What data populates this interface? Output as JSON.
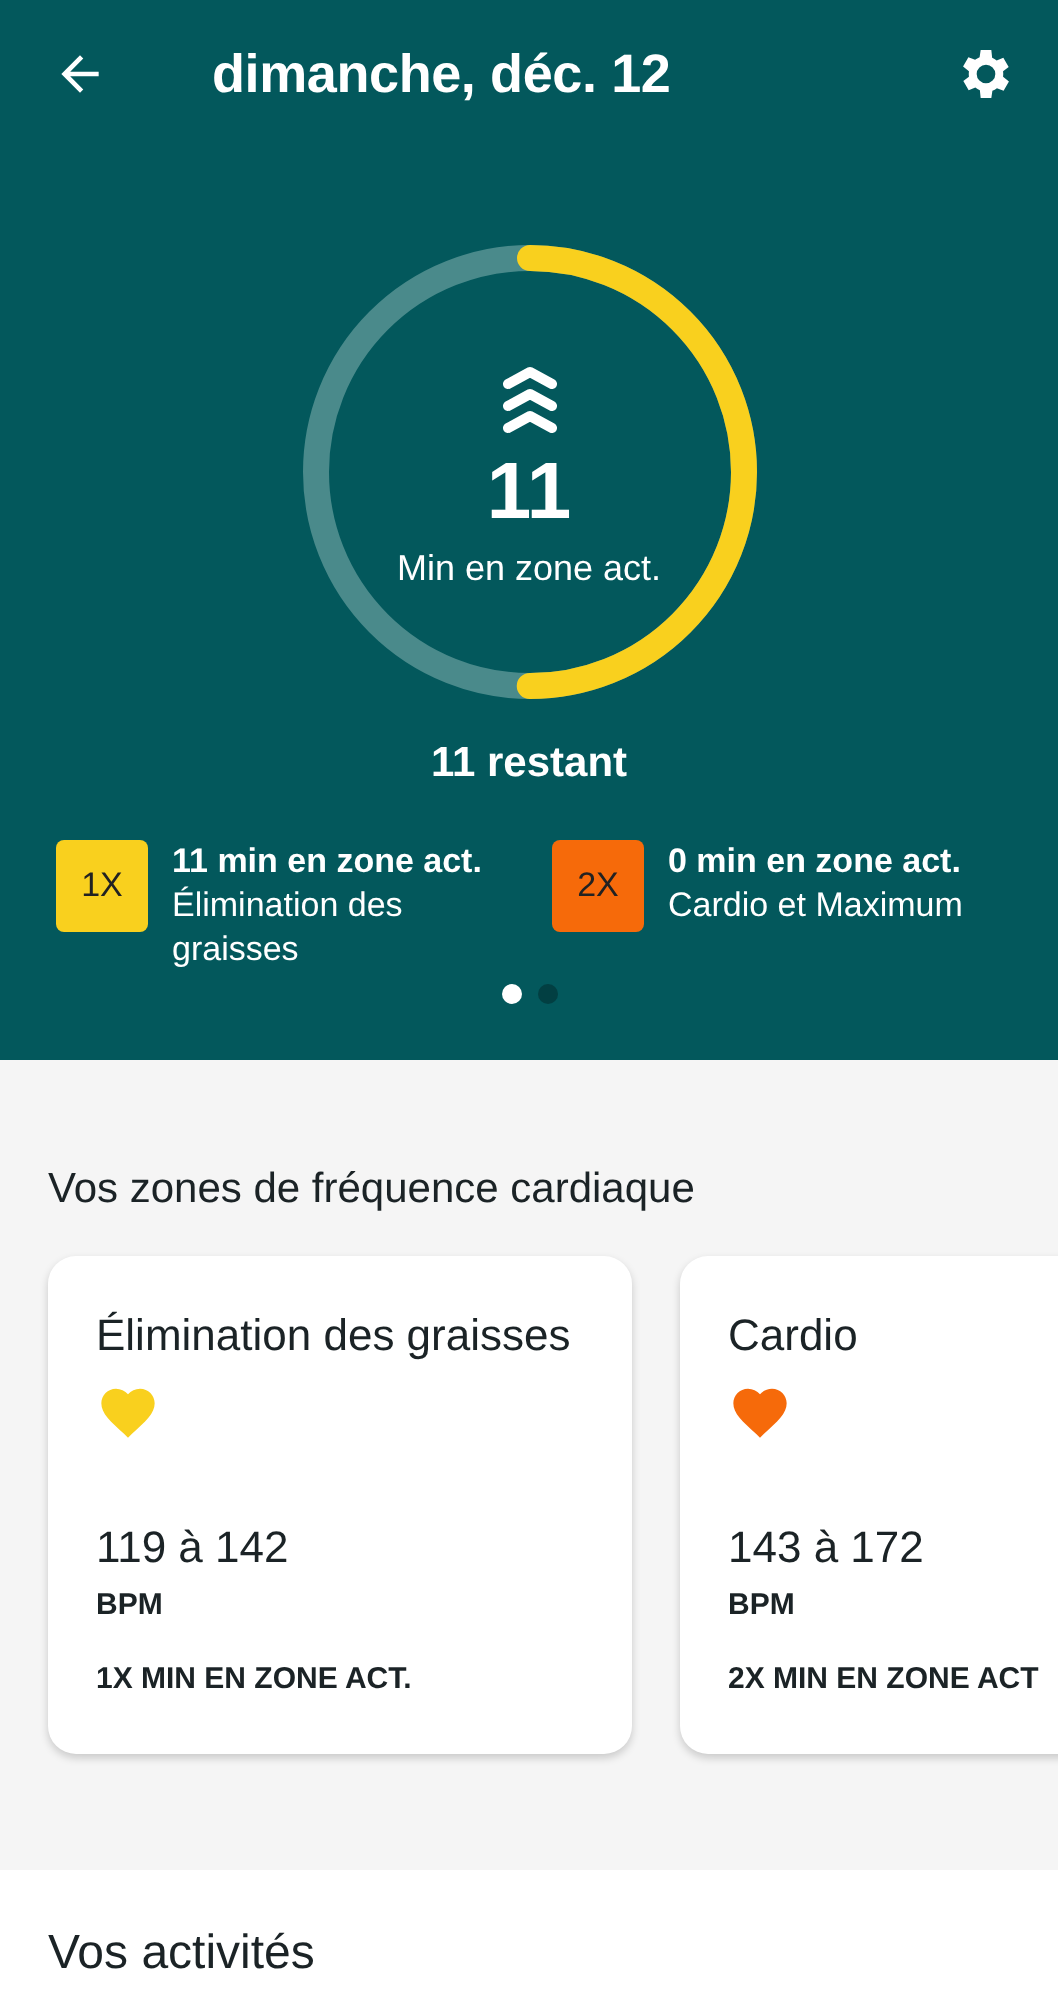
{
  "top_bar": {
    "title": "dimanche, déc. 12"
  },
  "ring": {
    "value": "11",
    "label": "Min en zone act."
  },
  "remaining": "11 restant",
  "legend": [
    {
      "badge": "1X",
      "color": "#f9d01e",
      "minutes": "11 min en zone act.",
      "zone": "Élimination des graisses"
    },
    {
      "badge": "2X",
      "color": "#f66a0a",
      "minutes": "0 min en zone act.",
      "zone": "Cardio et Maximum"
    }
  ],
  "page_dots": [
    {
      "selected": true
    },
    {
      "selected": false
    }
  ],
  "zones_section": {
    "title": "Vos zones de fréquence cardiaque",
    "cards": [
      {
        "title": "Élimination des graisses",
        "color": "#f9d01e",
        "range": "119 à 142",
        "unit": "BPM",
        "multiplier": "1X MIN EN ZONE ACT."
      },
      {
        "title": "Cardio",
        "color": "#f66a0a",
        "range": "143 à 172",
        "unit": "BPM",
        "multiplier": "2X MIN EN ZONE ACT"
      }
    ]
  },
  "activities_section": {
    "title": "Vos activités"
  }
}
